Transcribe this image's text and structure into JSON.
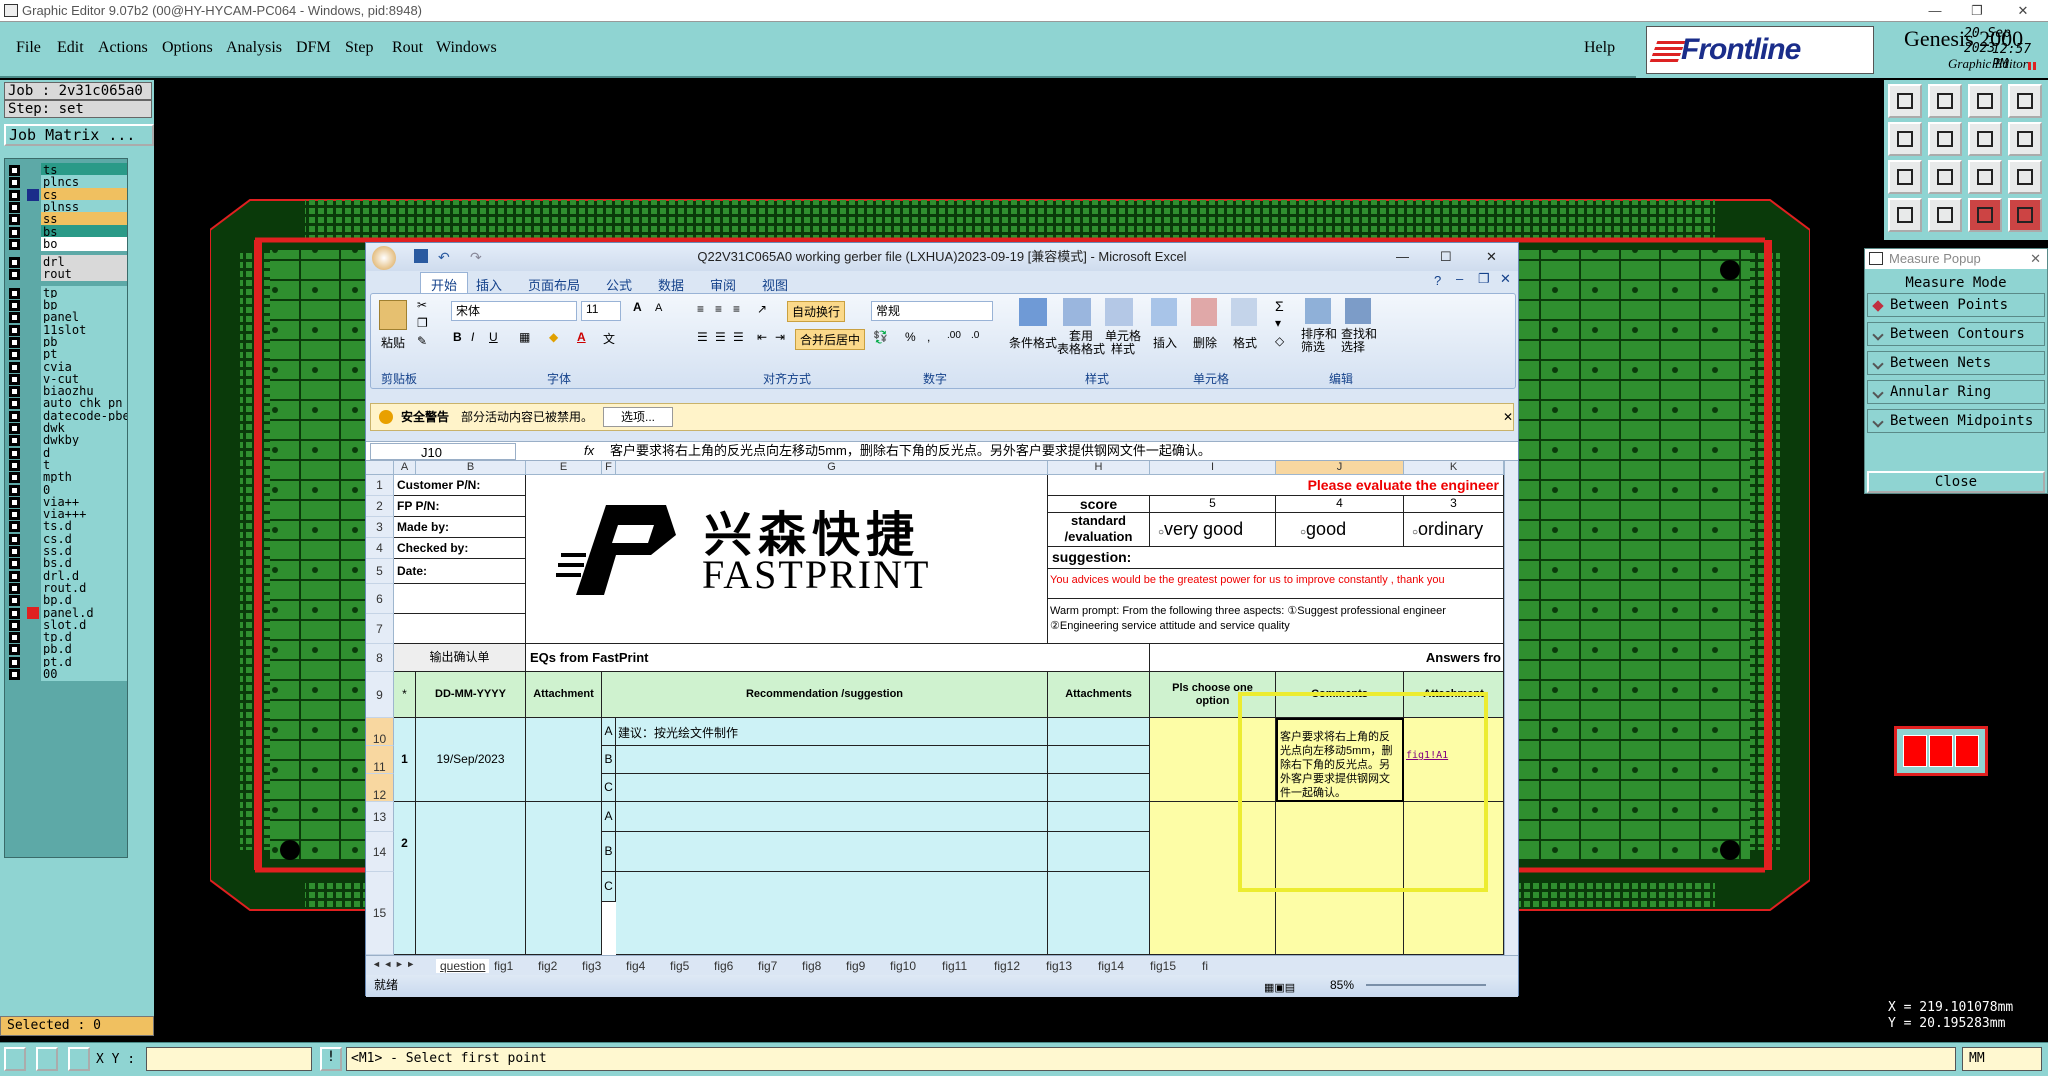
{
  "window": {
    "title": "Graphic Editor 9.07b2 (00@HY-HYCAM-PC064 - Windows, pid:8948)"
  },
  "menu": [
    "File",
    "Edit",
    "Actions",
    "Options",
    "Analysis",
    "DFM",
    "Step",
    "Rout",
    "Windows"
  ],
  "help": "Help",
  "brand": {
    "logo": "Frontline",
    "product": "Genesis 2000",
    "sub": "Graphic Editor",
    "date": "20 Sep 2023",
    "time": "12:57 PM"
  },
  "job": {
    "job_line": "Job : 2v31c065a0",
    "step_line": "Step: set",
    "matrix_button": "Job Matrix ..."
  },
  "layers": [
    {
      "name": "ts",
      "color": "#2a9a88",
      "sel": true
    },
    {
      "name": "plncs",
      "color": "#8fd4d2",
      "sel": false
    },
    {
      "name": "cs",
      "color": "#f0c060",
      "sel": true,
      "active": true
    },
    {
      "name": "plnss",
      "color": "#8fd4d2",
      "sel": false
    },
    {
      "name": "ss",
      "color": "#f0c060",
      "sel": true
    },
    {
      "name": "bs",
      "color": "#2a9a88",
      "sel": true
    },
    {
      "name": "bo",
      "color": "#ffffff",
      "sel": false
    },
    {
      "name": "drl",
      "color": "#d9d9d9",
      "sel": false
    },
    {
      "name": "rout",
      "color": "#d9d9d9",
      "sel": false
    },
    {
      "name": "tp",
      "color": "#8fd4d2"
    },
    {
      "name": "bp",
      "color": "#8fd4d2"
    },
    {
      "name": "panel",
      "color": "#8fd4d2"
    },
    {
      "name": "11slot",
      "color": "#8fd4d2"
    },
    {
      "name": "pb",
      "color": "#8fd4d2"
    },
    {
      "name": "pt",
      "color": "#8fd4d2"
    },
    {
      "name": "cvia",
      "color": "#8fd4d2"
    },
    {
      "name": "v-cut",
      "color": "#8fd4d2"
    },
    {
      "name": "biaozhu",
      "color": "#8fd4d2"
    },
    {
      "name": "auto_chk_pn",
      "color": "#8fd4d2"
    },
    {
      "name": "datecode-pbe",
      "color": "#8fd4d2"
    },
    {
      "name": "dwk",
      "color": "#8fd4d2"
    },
    {
      "name": "dwkby",
      "color": "#8fd4d2"
    },
    {
      "name": "d",
      "color": "#8fd4d2"
    },
    {
      "name": "t",
      "color": "#8fd4d2"
    },
    {
      "name": "mpth",
      "color": "#8fd4d2"
    },
    {
      "name": "0",
      "color": "#8fd4d2"
    },
    {
      "name": "via++",
      "color": "#8fd4d2"
    },
    {
      "name": "via+++",
      "color": "#8fd4d2"
    },
    {
      "name": "ts.d",
      "color": "#8fd4d2"
    },
    {
      "name": "cs.d",
      "color": "#8fd4d2"
    },
    {
      "name": "ss.d",
      "color": "#8fd4d2"
    },
    {
      "name": "bs.d",
      "color": "#8fd4d2"
    },
    {
      "name": "drl.d",
      "color": "#8fd4d2"
    },
    {
      "name": "rout.d",
      "color": "#8fd4d2"
    },
    {
      "name": "bp.d",
      "color": "#8fd4d2"
    },
    {
      "name": "panel.d",
      "color": "#8fd4d2",
      "red": true
    },
    {
      "name": "slot.d",
      "color": "#8fd4d2"
    },
    {
      "name": "tp.d",
      "color": "#8fd4d2"
    },
    {
      "name": "pb.d",
      "color": "#8fd4d2"
    },
    {
      "name": "pt.d",
      "color": "#8fd4d2"
    },
    {
      "name": "00",
      "color": "#8fd4d2"
    }
  ],
  "selected_text": "Selected : 0",
  "excel": {
    "title": "Q22V31C065A0 working gerber file (LXHUA)2023-09-19  [兼容模式] - Microsoft Excel",
    "tabs": [
      "开始",
      "插入",
      "页面布局",
      "公式",
      "数据",
      "审阅",
      "视图"
    ],
    "groups": [
      "剪贴板",
      "字体",
      "对齐方式",
      "数字",
      "样式",
      "单元格",
      "编辑"
    ],
    "font_name": "宋体",
    "font_size": "11",
    "number_format": "常规",
    "wrap_btn": "自动换行",
    "merge_btn": "合并后居中",
    "paste": "粘贴",
    "style_btns": [
      "条件格式",
      "套用\n表格格式",
      "单元格\n样式"
    ],
    "cell_btns": [
      "插入",
      "删除",
      "格式"
    ],
    "edit_btns": [
      "排序和\n筛选",
      "查找和\n选择"
    ],
    "security_title": "安全警告",
    "security_msg": "部分活动内容已被禁用。",
    "security_btn": "选项...",
    "namebox": "J10",
    "formula": "客户要求将右上角的反光点向左移动5mm，删除右下角的反光点。另外客户要求提供钢网文件一起确认。",
    "cols": [
      "A",
      "B",
      "E",
      "F",
      "G",
      "H",
      "I",
      "J",
      "K"
    ],
    "rows": [
      "1",
      "2",
      "3",
      "4",
      "5",
      "6",
      "7",
      "8",
      "9",
      "10",
      "11",
      "12",
      "13",
      "14",
      "15"
    ],
    "labels": {
      "customer": "Customer P/N:",
      "fp": "FP P/N:",
      "made": "Made by:",
      "checked": "Checked by:",
      "date": "Date:"
    },
    "logo_cn": "兴森快捷",
    "logo_en": "FASTPRINT",
    "please": "Please evaluate the engineer",
    "score_label": "score",
    "scores": [
      "5",
      "4",
      "3"
    ],
    "std_label": "standard\n/evaluation",
    "evals": [
      "very good",
      "good",
      "ordinary"
    ],
    "suggestion": "suggestion:",
    "advice": "You advices would be the greatest power for us to improve constantly ,   thank you",
    "warm1": "Warm prompt:  From the following three aspects: ①Suggest professional engineer",
    "warm2": "②Engineering service attitude and service quality",
    "out_confirm": "输出确认单",
    "eqs": "EQs from FastPrint",
    "answers": "Answers fro",
    "h_star": "*",
    "h_date": "DD-MM-YYYY",
    "h_attach": "Attachment",
    "h_rec": "Recommendation /suggestion",
    "h_attachs": "Attachments",
    "h_choose": "Pls choose one\noption",
    "h_comments": "Comments",
    "h_attach2": "Attachment",
    "item1": "1",
    "item1_date": "19/Sep/2023",
    "item2": "2",
    "sub_a": "A",
    "sub_b": "B",
    "sub_c": "C",
    "rec_a": "建议：按光绘文件制作",
    "comment": "客户要求将右上角的反光点向左移动5mm，删除右下角的反光点。另外客户要求提供钢网文件一起确认。",
    "fig_link": "fig1!A1",
    "sheet_tabs": [
      "question",
      "fig1",
      "fig2",
      "fig3",
      "fig4",
      "fig5",
      "fig6",
      "fig7",
      "fig8",
      "fig9",
      "fig10",
      "fig11",
      "fig12",
      "fig13",
      "fig14",
      "fig15",
      "fi"
    ],
    "status": "就绪",
    "zoom": "85%"
  },
  "measure": {
    "title": "Measure Popup",
    "mode": "Measure Mode",
    "options": [
      "Between Points",
      "Between Contours",
      "Between Nets",
      "Annular Ring",
      "Between Midpoints"
    ],
    "close": "Close"
  },
  "coords": {
    "x": "X = 219.101078mm",
    "y": "Y = 20.195283mm"
  },
  "bottom": {
    "xy_label": "X Y :",
    "prompt": "<M1> - Select first point",
    "mode": "MM"
  },
  "colors": {
    "board": "#2f8f2f",
    "board_bg": "#0a3a0a",
    "frame": "#e02020",
    "teal": "#8fd4d2"
  }
}
